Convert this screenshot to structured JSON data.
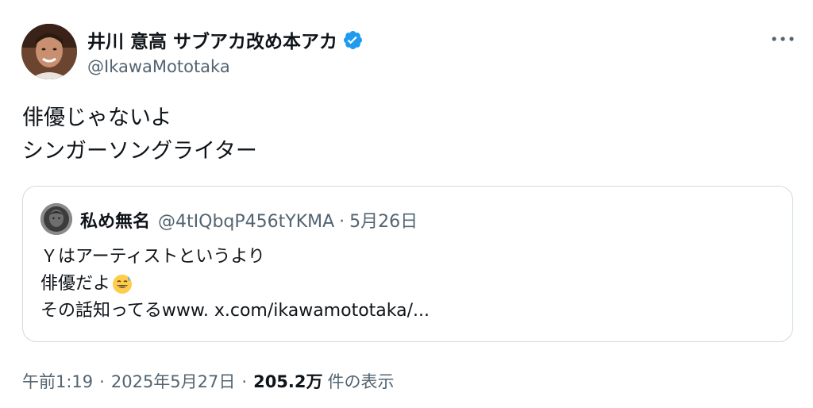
{
  "author": {
    "name": "井川 意高 サブアカ改め本アカ",
    "handle": "@IkawaMototaka",
    "verified": true
  },
  "tweet": {
    "lines": [
      "俳優じゃないよ",
      "シンガーソングライター"
    ]
  },
  "quote": {
    "name": "私め無名",
    "handle": "@4tIQbqP456tYKMA",
    "separator": "·",
    "date": "5月26日",
    "lines": [
      "Ｙはアーティストというより",
      "俳優だよ",
      "その話知ってるwww. x.com/ikawamototaka/..."
    ],
    "emoji": "grinning-sweat-emoji"
  },
  "meta": {
    "time": "午前1:19",
    "separator": "·",
    "date": "2025年5月27日",
    "views_count": "205.2万",
    "views_label": "件の表示"
  },
  "colors": {
    "text": "#0f1419",
    "secondary": "#536471",
    "verified": "#1d9bf0",
    "border": "#cfd9de"
  }
}
